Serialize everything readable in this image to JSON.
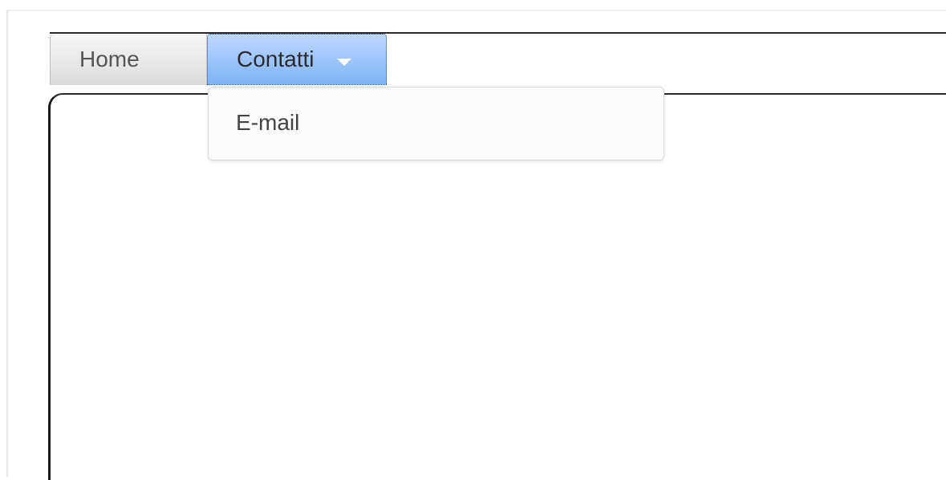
{
  "nav": {
    "tabs": [
      {
        "label": "Home",
        "active": false
      },
      {
        "label": "Contatti",
        "active": true,
        "has_dropdown": true
      }
    ],
    "dropdown": {
      "items": [
        {
          "label": "E-mail"
        }
      ]
    }
  },
  "colors": {
    "active_tab_top": "#bcd8ff",
    "active_tab_bottom": "#7fb2f5",
    "inactive_tab": "#dcdcdc",
    "border": "#1a1a1a"
  },
  "icons": {
    "dropdown_caret": "chevron-down-icon"
  }
}
